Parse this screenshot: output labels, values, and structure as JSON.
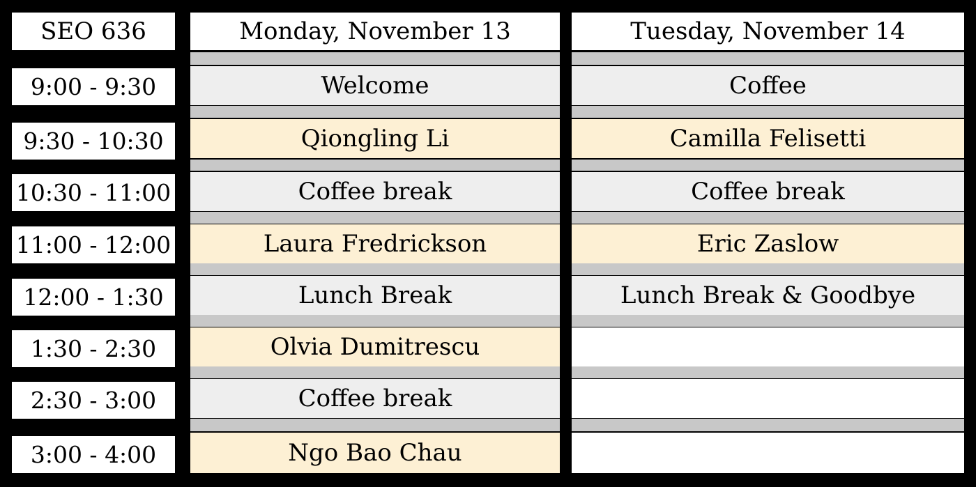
{
  "header": {
    "corner": "SEO 636",
    "days": [
      "Monday, November 13",
      "Tuesday, November 14"
    ]
  },
  "colors": {
    "talk": "#fdf0d4",
    "break": "#eeeeee",
    "empty": "#ffffff",
    "separator": "#c8c8c8",
    "background": "#000000"
  },
  "rows": [
    {
      "time": "9:00 - 9:30",
      "monday": "Welcome",
      "monday_kind": "break",
      "tuesday": "Coffee",
      "tuesday_kind": "break"
    },
    {
      "time": "9:30 - 10:30",
      "monday": "Qiongling Li",
      "monday_kind": "talk",
      "tuesday": "Camilla Felisetti",
      "tuesday_kind": "talk"
    },
    {
      "time": "10:30 - 11:00",
      "monday": "Coffee break",
      "monday_kind": "break",
      "tuesday": "Coffee break",
      "tuesday_kind": "break"
    },
    {
      "time": "11:00 - 12:00",
      "monday": "Laura Fredrickson",
      "monday_kind": "talk",
      "tuesday": "Eric Zaslow",
      "tuesday_kind": "talk"
    },
    {
      "time": "12:00 - 1:30",
      "monday": "Lunch Break",
      "monday_kind": "break",
      "tuesday": "Lunch Break & Goodbye",
      "tuesday_kind": "break"
    },
    {
      "time": "1:30 - 2:30",
      "monday": "Olvia Dumitrescu",
      "monday_kind": "talk",
      "tuesday": "",
      "tuesday_kind": "empty"
    },
    {
      "time": "2:30 - 3:00",
      "monday": "Coffee break",
      "monday_kind": "break",
      "tuesday": "",
      "tuesday_kind": "empty"
    },
    {
      "time": "3:00 - 4:00",
      "monday": "Ngo Bao Chau",
      "monday_kind": "talk",
      "tuesday": "",
      "tuesday_kind": "empty"
    }
  ]
}
